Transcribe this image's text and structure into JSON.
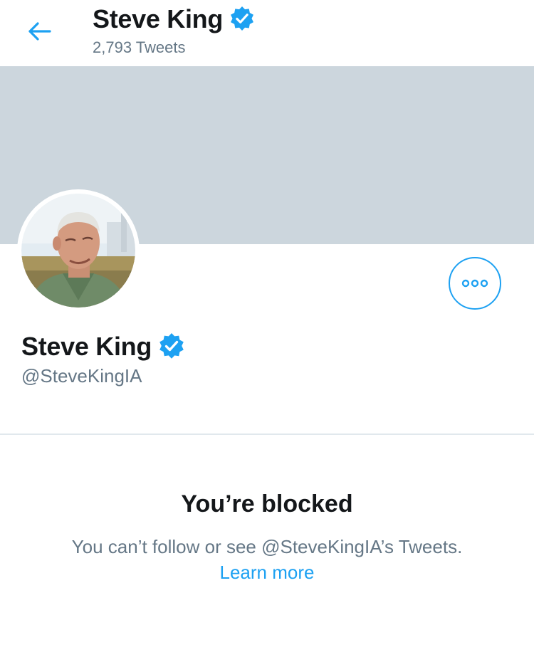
{
  "header": {
    "title": "Steve King",
    "tweet_count": "2,793 Tweets"
  },
  "profile": {
    "name": "Steve King",
    "handle": "@SteveKingIA",
    "verified": true
  },
  "blocked": {
    "title": "You’re blocked",
    "message": "You can’t follow or see @SteveKingIA’s Tweets.",
    "link": "Learn more"
  },
  "colors": {
    "accent": "#1da1f2",
    "banner": "#ccd6dd",
    "secondary_text": "#657786",
    "primary_text": "#14171a",
    "divider": "#e1e8ed"
  },
  "icons": {
    "back": "arrow-left-icon",
    "verified": "verified-badge-icon",
    "more": "more-options-icon"
  }
}
